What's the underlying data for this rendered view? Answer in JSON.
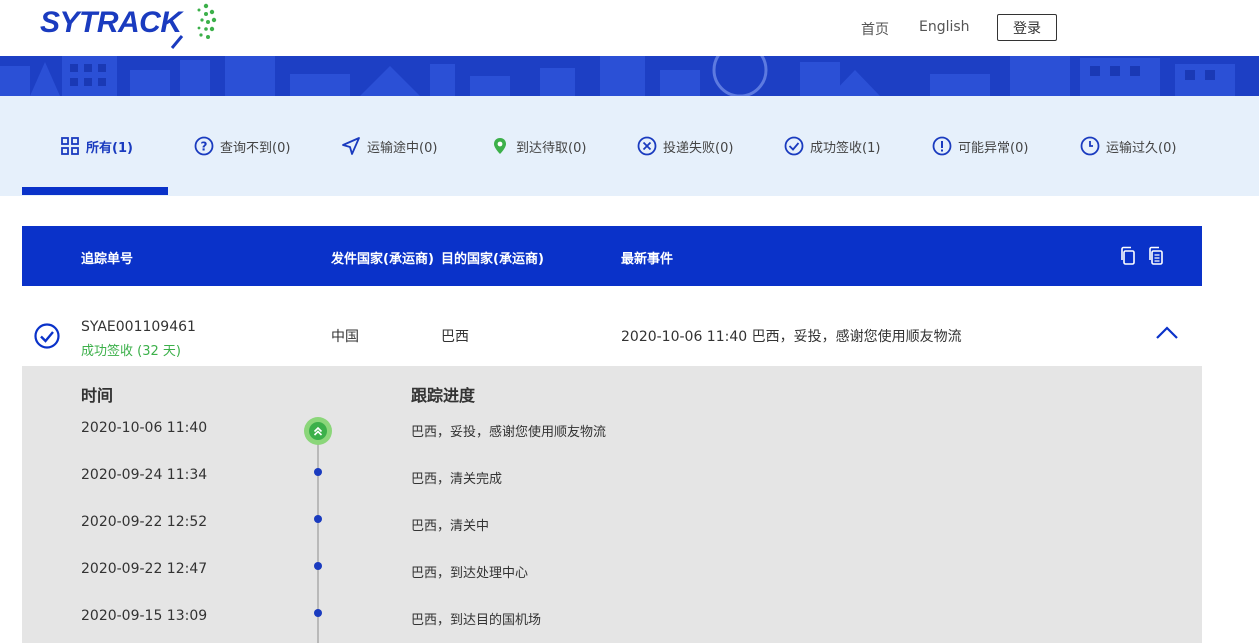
{
  "header": {
    "logo_text": "SYTRACK",
    "nav_home": "首页",
    "nav_english": "English",
    "login": "登录"
  },
  "tabs": [
    {
      "label": "所有(1)",
      "icon": "grid-icon",
      "active": true
    },
    {
      "label": "查询不到(0)",
      "icon": "question-circle-icon",
      "active": false
    },
    {
      "label": "运输途中(0)",
      "icon": "send-arrow-icon",
      "active": false
    },
    {
      "label": "到达待取(0)",
      "icon": "location-pin-icon",
      "active": false
    },
    {
      "label": "投递失败(0)",
      "icon": "x-circle-icon",
      "active": false
    },
    {
      "label": "成功签收(1)",
      "icon": "check-circle-icon",
      "active": false
    },
    {
      "label": "可能异常(0)",
      "icon": "exclamation-circle-icon",
      "active": false
    },
    {
      "label": "运输过久(0)",
      "icon": "clock-icon",
      "active": false
    }
  ],
  "table": {
    "col_tracking": "追踪单号",
    "col_origin": "发件国家(承运商)",
    "col_dest": "目的国家(承运商)",
    "col_latest": "最新事件"
  },
  "shipment": {
    "tracking_no": "SYAE001109461",
    "status": "成功签收 (32 天)",
    "origin": "中国",
    "dest": "巴西",
    "latest_event": "2020-10-06 11:40 巴西，妥投，感谢您使用顺友物流"
  },
  "details": {
    "col_time": "时间",
    "col_progress": "跟踪进度",
    "events": [
      {
        "time": "2020-10-06 11:40",
        "desc": "巴西，妥投，感谢您使用顺友物流"
      },
      {
        "time": "2020-09-24 11:34",
        "desc": "巴西，清关完成"
      },
      {
        "time": "2020-09-22 12:52",
        "desc": "巴西，清关中"
      },
      {
        "time": "2020-09-22 12:47",
        "desc": "巴西，到达处理中心"
      },
      {
        "time": "2020-09-15 13:09",
        "desc": "巴西，到达目的国机场"
      }
    ]
  },
  "colors": {
    "brand_blue": "#0a32c9",
    "success_green": "#3cb04a",
    "tab_bg": "#e6f0fb"
  }
}
